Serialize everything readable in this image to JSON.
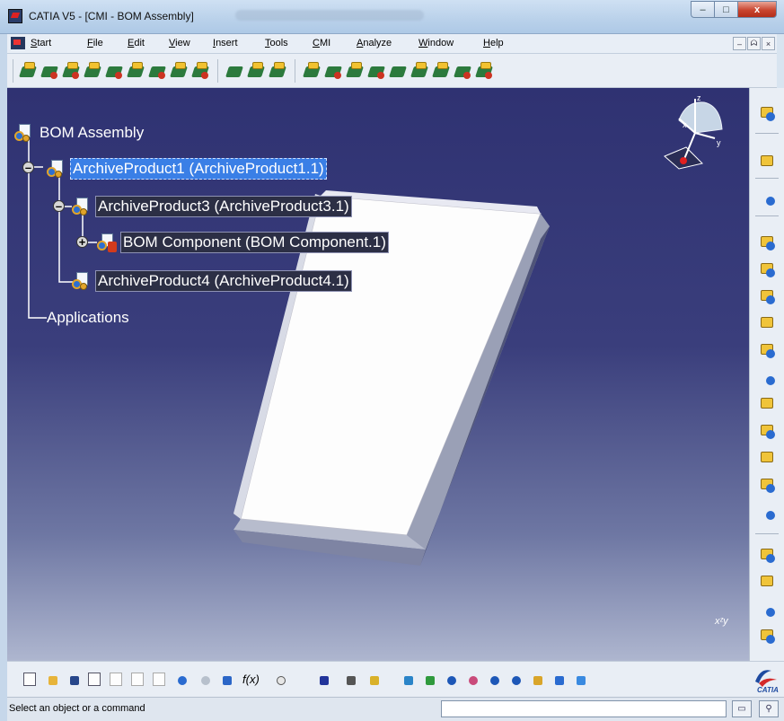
{
  "window": {
    "title": "CATIA V5 - [CMI - BOM Assembly]",
    "controls": {
      "minimize": "–",
      "maximize": "□",
      "close": "x"
    }
  },
  "menubar": {
    "items": [
      {
        "label": "Start",
        "accel": "S",
        "rest": "tart"
      },
      {
        "label": "File",
        "accel": "F",
        "rest": "ile"
      },
      {
        "label": "Edit",
        "accel": "E",
        "rest": "dit"
      },
      {
        "label": "View",
        "accel": "V",
        "rest": "iew"
      },
      {
        "label": "Insert",
        "accel": "I",
        "rest": "nsert"
      },
      {
        "label": "Tools",
        "accel": "T",
        "rest": "ools"
      },
      {
        "label": "CMI",
        "accel": "C",
        "rest": "MI"
      },
      {
        "label": "Analyze",
        "accel": "A",
        "rest": "nalyze"
      },
      {
        "label": "Window",
        "accel": "W",
        "rest": "indow"
      },
      {
        "label": "Help",
        "accel": "H",
        "rest": "elp"
      }
    ],
    "mdi": {
      "minimize": "–",
      "restore": "ᗣ",
      "close": "×"
    }
  },
  "tree": {
    "root": "BOM Assembly",
    "nodes": {
      "p1": "ArchiveProduct1 (ArchiveProduct1.1)",
      "p3": "ArchiveProduct3 (ArchiveProduct3.1)",
      "bom": "BOM Component (BOM Component.1)",
      "p4": "ArchiveProduct4 (ArchiveProduct4.1)"
    },
    "applications": "Applications",
    "expanders": {
      "minus": "–",
      "plus": "+"
    }
  },
  "compass": {
    "x": "x",
    "y": "y",
    "z": "z"
  },
  "axis_glyph": "xᶻy",
  "bottom_toolbar": {
    "formula_label": "f(x)",
    "logo": "CATIA"
  },
  "statusbar": {
    "message": "Select an object or a command",
    "command_value": ""
  },
  "colors": {
    "viewport_top": "#2f3272",
    "viewport_bottom": "#aeb6cf",
    "selection": "#3a7fe6",
    "part_face": "#fdfdfd"
  }
}
